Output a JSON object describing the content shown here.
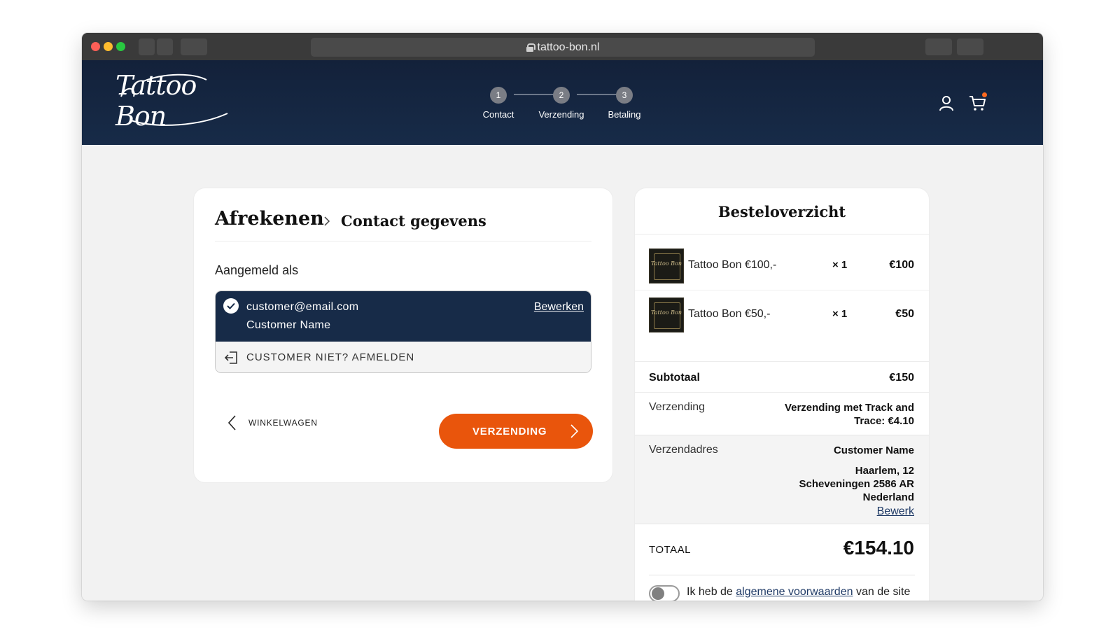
{
  "browser": {
    "url": "tattoo-bon.nl"
  },
  "header": {
    "logo_text": "Tattoo Bon",
    "steps": [
      {
        "number": "1",
        "label": "Contact"
      },
      {
        "number": "2",
        "label": "Verzending"
      },
      {
        "number": "3",
        "label": "Betaling"
      }
    ]
  },
  "checkout": {
    "title": "Afrekenen",
    "subtitle": "Contact gegevens",
    "signed_in_label": "Aangemeld als",
    "account": {
      "email": "customer@email.com",
      "name": "Customer Name",
      "edit_label": "Bewerken",
      "logout_label": "CUSTOMER NIET? AFMELDEN"
    },
    "back_label": "WINKELWAGEN",
    "next_label": "VERZENDING"
  },
  "summary": {
    "title": "Besteloverzicht",
    "items": [
      {
        "name": "Tattoo Bon €100,-",
        "qty": "× 1",
        "price": "€100"
      },
      {
        "name": "Tattoo Bon €50,-",
        "qty": "× 1",
        "price": "€50"
      }
    ],
    "subtotal_label": "Subtotaal",
    "subtotal_value": "€150",
    "shipping_label": "Verzending",
    "shipping_value": "Verzending met Track and Trace: €4.10",
    "address_label": "Verzendadres",
    "address_name": "Customer Name",
    "address_line1": "Haarlem, 12",
    "address_line2": "Scheveningen 2586 AR",
    "address_line3": "Nederland",
    "address_edit": "Bewerk",
    "total_label": "TOTAAL",
    "total_value": "€154.10",
    "terms_prefix": "Ik heb de",
    "terms_link": "algemene voorwaarden",
    "terms_suffix": "van de site gelezen en ga hiermee akkoord"
  },
  "colors": {
    "header_bg": "#172b48",
    "accent": "#e9550c",
    "cart_badge": "#ff6a1f"
  }
}
